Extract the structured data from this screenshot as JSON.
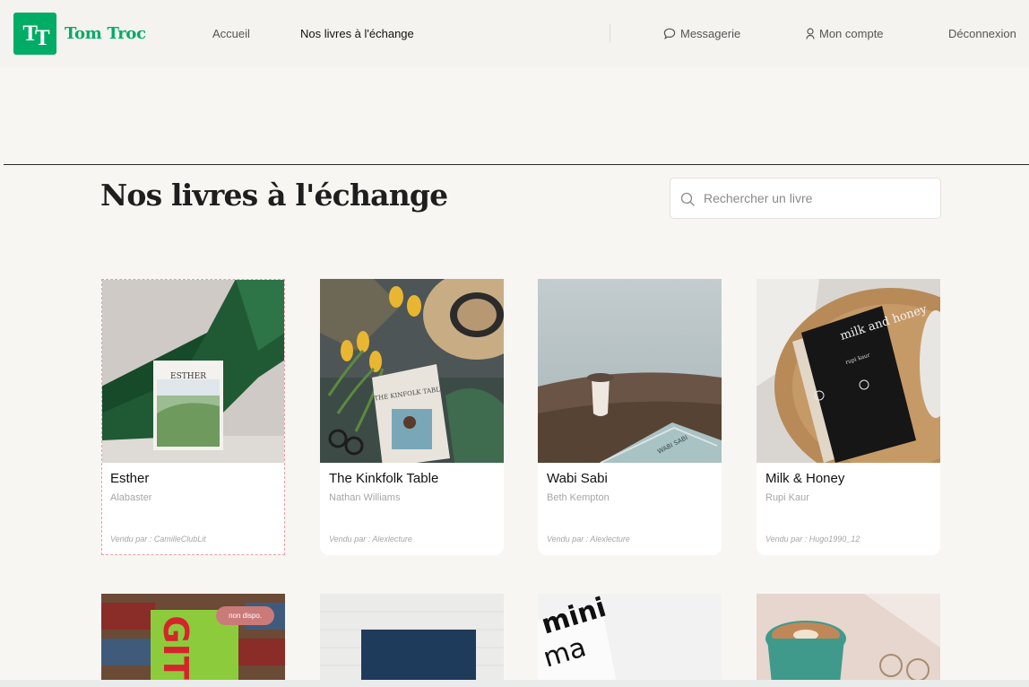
{
  "header": {
    "logo_text": "TT",
    "brand": "Tom Troc",
    "nav": {
      "home": "Accueil",
      "books": "Nos livres à l'échange",
      "messages": "Messagerie",
      "account": "Mon compte",
      "logout": "Déconnexion"
    }
  },
  "page": {
    "title": "Nos livres à l'échange"
  },
  "search": {
    "placeholder": "Rechercher un livre",
    "value": ""
  },
  "books": [
    {
      "title": "Esther",
      "author": "Alabaster",
      "seller": "Vendu par : CamilleClubLit",
      "cover_text": "ESTHER",
      "selected": true
    },
    {
      "title": "The Kinkfolk Table",
      "author": "Nathan Williams",
      "seller": "Vendu par : Alexlecture",
      "cover_text": "THE KINFOLK TABLE"
    },
    {
      "title": "Wabi Sabi",
      "author": "Beth Kempton",
      "seller": "Vendu par : Alexlecture",
      "cover_text": "WABI SABI"
    },
    {
      "title": "Milk & Honey",
      "author": "Rupi Kaur",
      "seller": "Vendu par : Hugo1990_12",
      "cover_text": "milk and honey",
      "cover_subtext": "rupi kaur"
    }
  ],
  "second_row": [
    {
      "badge": "non dispo."
    },
    {},
    {
      "cover_text": "mini ma"
    },
    {}
  ],
  "colors": {
    "brand_green": "#00ac66",
    "badge": "#ca7b79",
    "background": "#f8f6f3"
  }
}
